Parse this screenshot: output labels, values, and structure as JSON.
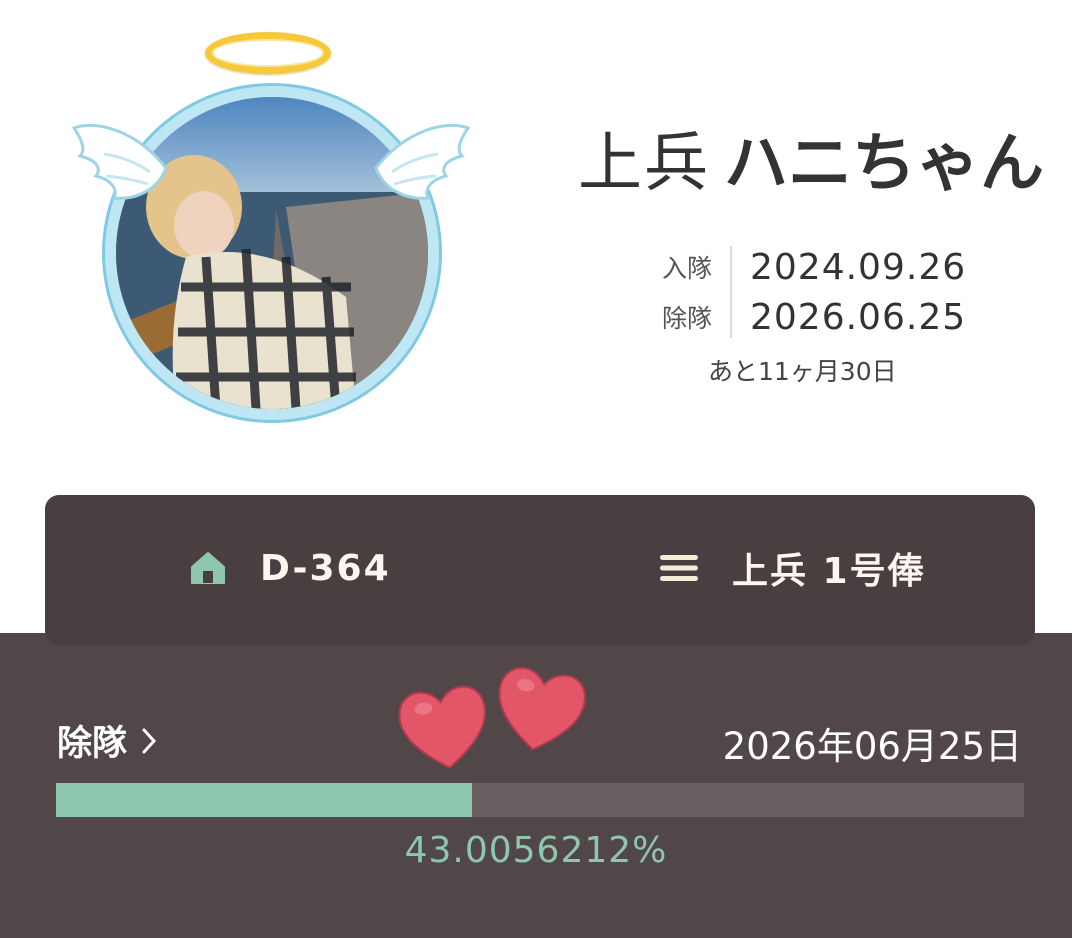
{
  "profile": {
    "rank": "上兵",
    "nickname": "ハニちゃん",
    "enlist_label": "入隊",
    "enlist_date": "2024.09.26",
    "discharge_label": "除隊",
    "discharge_date": "2026.06.25",
    "remaining": "あと11ヶ月30日"
  },
  "card": {
    "dday": "D-364",
    "dday_icon": "home-icon",
    "rank_pay": "上兵 1号俸",
    "rank_pay_icon": "menu-icon"
  },
  "progress": {
    "label": "除隊",
    "date": "2026年06月25日",
    "percent_text": "43.0056212%",
    "fraction": 0.430056212
  },
  "colors": {
    "accent": "#8ec6b0",
    "card_bg": "#4a3f40",
    "panel_bg": "#524748",
    "heart": "#e25668",
    "halo": "#f5c93a",
    "frame": "#bfe6f3"
  }
}
